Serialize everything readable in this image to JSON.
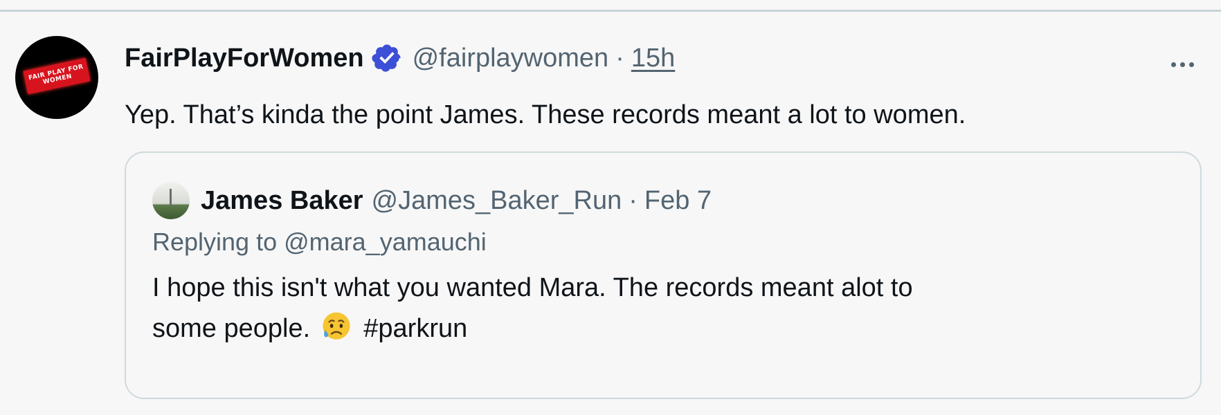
{
  "tweet": {
    "display_name": "FairPlayForWomen",
    "verified_icon": "verified-badge-icon",
    "handle": "@fairplaywomen",
    "separator": "·",
    "time": "15h",
    "text": "Yep. That’s kinda the point James. These records meant a lot to women.",
    "avatar_icon": "fair-play-for-women-logo",
    "avatar_sign_text": "FAIR PLAY FOR WOMEN",
    "more_icon": "more-options-icon"
  },
  "quote": {
    "display_name": "James Baker",
    "handle": "@James_Baker_Run",
    "separator": "·",
    "date": "Feb 7",
    "replying_to": "Replying to @mara_yamauchi",
    "text_line1": "I hope this isn't what you wanted Mara. The records meant alot to",
    "text_line2_before": "some people.",
    "emoji_icon": "sad-but-relieved-face-icon",
    "hashtag": "#parkrun",
    "avatar_icon": "user-avatar"
  },
  "colors": {
    "background": "#f7f7f7",
    "text_primary": "#0f1419",
    "text_secondary": "#536471",
    "verified_blue": "#3d4fd6",
    "border": "#cfd9de"
  }
}
